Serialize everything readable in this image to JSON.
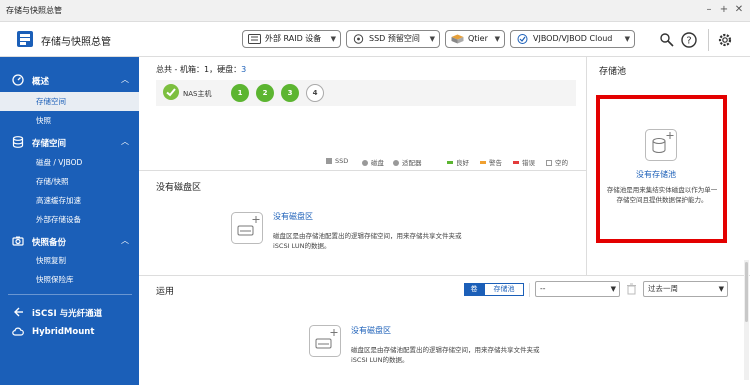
{
  "window": {
    "title": "存储与快照总管",
    "minimize": "–",
    "maximize": "+",
    "close": "✕"
  },
  "app": {
    "title": "存储与快照总管"
  },
  "toolbar": {
    "external_raid": "外部 RAID 设备",
    "ssd_profiling": "SSD 预留空间",
    "qtier": "Qtier",
    "vjbod": "VJBOD/VJBOD Cloud"
  },
  "sidebar": {
    "overview": {
      "label": "概述",
      "items": [
        "存储空间",
        "快照"
      ]
    },
    "storage": {
      "label": "存储空间",
      "items": [
        "磁盘 / VJBOD",
        "存储/快照",
        "高速缓存加速",
        "外部存储设备"
      ]
    },
    "snapshot_backup": {
      "label": "快照备份",
      "items": [
        "快照复制",
        "快照保险库"
      ]
    },
    "iscsi": "iSCSI 与光纤通道",
    "hybridmount": "HybridMount"
  },
  "summary": {
    "prefix": "总共 - 机箱：",
    "enclosures": "1",
    "disk_prefix": "，硬盘：",
    "disks": "3",
    "nas_label": "NAS主机",
    "disk_numbers": [
      "1",
      "2",
      "3",
      "4"
    ]
  },
  "legend": [
    {
      "label": "SSD",
      "color": "#999999",
      "shape": "square"
    },
    {
      "label": "磁盘",
      "color": "#999999",
      "shape": "round"
    },
    {
      "label": "适配器",
      "color": "#999999",
      "shape": "round"
    },
    {
      "label": "良好",
      "color": "#5cb531",
      "shape": "bar"
    },
    {
      "label": "警告",
      "color": "#f0a030",
      "shape": "bar"
    },
    {
      "label": "错误",
      "color": "#e33b3b",
      "shape": "bar"
    },
    {
      "label": "空的",
      "color": "#ffffff",
      "shape": "square-outline"
    }
  ],
  "pool": {
    "title": "存储池",
    "link": "没有存储池",
    "desc": "存储池是用来集结实体磁盘以作为单一存储空间且提供数据保护能力。"
  },
  "disk_area": {
    "title": "没有磁盘区",
    "link": "没有磁盘区",
    "desc_line1": "磁盘区是由存储池配置出的逻辑存储空间，用来存储共享文件夹或",
    "desc_line2": "iSCSI LUN的数据。"
  },
  "usage": {
    "title": "运用",
    "seg_volume": "卷",
    "seg_pool": "存储池",
    "filter_value": "--",
    "period_value": "过去一周",
    "link": "没有磁盘区",
    "desc_line1": "磁盘区是由存储池配置出的逻辑存储空间，用来存储共享文件夹或",
    "desc_line2": "iSCSI LUN的数据。"
  }
}
